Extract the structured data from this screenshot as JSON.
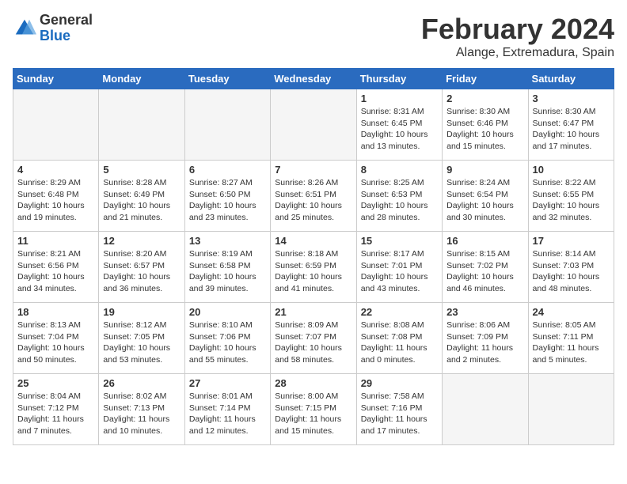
{
  "logo": {
    "general": "General",
    "blue": "Blue"
  },
  "title": "February 2024",
  "location": "Alange, Extremadura, Spain",
  "headers": [
    "Sunday",
    "Monday",
    "Tuesday",
    "Wednesday",
    "Thursday",
    "Friday",
    "Saturday"
  ],
  "weeks": [
    [
      {
        "day": "",
        "info": ""
      },
      {
        "day": "",
        "info": ""
      },
      {
        "day": "",
        "info": ""
      },
      {
        "day": "",
        "info": ""
      },
      {
        "day": "1",
        "info": "Sunrise: 8:31 AM\nSunset: 6:45 PM\nDaylight: 10 hours\nand 13 minutes."
      },
      {
        "day": "2",
        "info": "Sunrise: 8:30 AM\nSunset: 6:46 PM\nDaylight: 10 hours\nand 15 minutes."
      },
      {
        "day": "3",
        "info": "Sunrise: 8:30 AM\nSunset: 6:47 PM\nDaylight: 10 hours\nand 17 minutes."
      }
    ],
    [
      {
        "day": "4",
        "info": "Sunrise: 8:29 AM\nSunset: 6:48 PM\nDaylight: 10 hours\nand 19 minutes."
      },
      {
        "day": "5",
        "info": "Sunrise: 8:28 AM\nSunset: 6:49 PM\nDaylight: 10 hours\nand 21 minutes."
      },
      {
        "day": "6",
        "info": "Sunrise: 8:27 AM\nSunset: 6:50 PM\nDaylight: 10 hours\nand 23 minutes."
      },
      {
        "day": "7",
        "info": "Sunrise: 8:26 AM\nSunset: 6:51 PM\nDaylight: 10 hours\nand 25 minutes."
      },
      {
        "day": "8",
        "info": "Sunrise: 8:25 AM\nSunset: 6:53 PM\nDaylight: 10 hours\nand 28 minutes."
      },
      {
        "day": "9",
        "info": "Sunrise: 8:24 AM\nSunset: 6:54 PM\nDaylight: 10 hours\nand 30 minutes."
      },
      {
        "day": "10",
        "info": "Sunrise: 8:22 AM\nSunset: 6:55 PM\nDaylight: 10 hours\nand 32 minutes."
      }
    ],
    [
      {
        "day": "11",
        "info": "Sunrise: 8:21 AM\nSunset: 6:56 PM\nDaylight: 10 hours\nand 34 minutes."
      },
      {
        "day": "12",
        "info": "Sunrise: 8:20 AM\nSunset: 6:57 PM\nDaylight: 10 hours\nand 36 minutes."
      },
      {
        "day": "13",
        "info": "Sunrise: 8:19 AM\nSunset: 6:58 PM\nDaylight: 10 hours\nand 39 minutes."
      },
      {
        "day": "14",
        "info": "Sunrise: 8:18 AM\nSunset: 6:59 PM\nDaylight: 10 hours\nand 41 minutes."
      },
      {
        "day": "15",
        "info": "Sunrise: 8:17 AM\nSunset: 7:01 PM\nDaylight: 10 hours\nand 43 minutes."
      },
      {
        "day": "16",
        "info": "Sunrise: 8:15 AM\nSunset: 7:02 PM\nDaylight: 10 hours\nand 46 minutes."
      },
      {
        "day": "17",
        "info": "Sunrise: 8:14 AM\nSunset: 7:03 PM\nDaylight: 10 hours\nand 48 minutes."
      }
    ],
    [
      {
        "day": "18",
        "info": "Sunrise: 8:13 AM\nSunset: 7:04 PM\nDaylight: 10 hours\nand 50 minutes."
      },
      {
        "day": "19",
        "info": "Sunrise: 8:12 AM\nSunset: 7:05 PM\nDaylight: 10 hours\nand 53 minutes."
      },
      {
        "day": "20",
        "info": "Sunrise: 8:10 AM\nSunset: 7:06 PM\nDaylight: 10 hours\nand 55 minutes."
      },
      {
        "day": "21",
        "info": "Sunrise: 8:09 AM\nSunset: 7:07 PM\nDaylight: 10 hours\nand 58 minutes."
      },
      {
        "day": "22",
        "info": "Sunrise: 8:08 AM\nSunset: 7:08 PM\nDaylight: 11 hours\nand 0 minutes."
      },
      {
        "day": "23",
        "info": "Sunrise: 8:06 AM\nSunset: 7:09 PM\nDaylight: 11 hours\nand 2 minutes."
      },
      {
        "day": "24",
        "info": "Sunrise: 8:05 AM\nSunset: 7:11 PM\nDaylight: 11 hours\nand 5 minutes."
      }
    ],
    [
      {
        "day": "25",
        "info": "Sunrise: 8:04 AM\nSunset: 7:12 PM\nDaylight: 11 hours\nand 7 minutes."
      },
      {
        "day": "26",
        "info": "Sunrise: 8:02 AM\nSunset: 7:13 PM\nDaylight: 11 hours\nand 10 minutes."
      },
      {
        "day": "27",
        "info": "Sunrise: 8:01 AM\nSunset: 7:14 PM\nDaylight: 11 hours\nand 12 minutes."
      },
      {
        "day": "28",
        "info": "Sunrise: 8:00 AM\nSunset: 7:15 PM\nDaylight: 11 hours\nand 15 minutes."
      },
      {
        "day": "29",
        "info": "Sunrise: 7:58 AM\nSunset: 7:16 PM\nDaylight: 11 hours\nand 17 minutes."
      },
      {
        "day": "",
        "info": ""
      },
      {
        "day": "",
        "info": ""
      }
    ]
  ]
}
